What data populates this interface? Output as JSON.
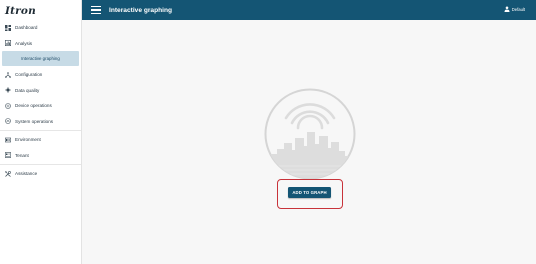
{
  "brand": {
    "logo_text": "Itron"
  },
  "header": {
    "title": "Interactive graphing",
    "user_name": "Default"
  },
  "sidebar": {
    "items": [
      {
        "label": "Dashboard",
        "icon": "dashboard-icon"
      },
      {
        "label": "Analysis",
        "icon": "analysis-icon"
      },
      {
        "label": "Interactive graphing",
        "selected": true
      },
      {
        "label": "Configuration",
        "icon": "configuration-icon"
      },
      {
        "label": "Data quality",
        "icon": "data-quality-icon"
      },
      {
        "label": "Device operations",
        "icon": "device-operations-icon"
      },
      {
        "label": "System operations",
        "icon": "system-operations-icon"
      },
      {
        "label": "Environment",
        "icon": "environment-icon"
      },
      {
        "label": "Tenant",
        "icon": "tenant-icon"
      },
      {
        "label": "Assistance",
        "icon": "assistance-icon"
      }
    ]
  },
  "main": {
    "add_button_label": "ADD TO GRAPH"
  },
  "colors": {
    "header_bg": "#145574",
    "selected_item_bg": "#c7dbe6",
    "highlight_border": "#c8333a",
    "content_bg": "#f7f7f7"
  }
}
